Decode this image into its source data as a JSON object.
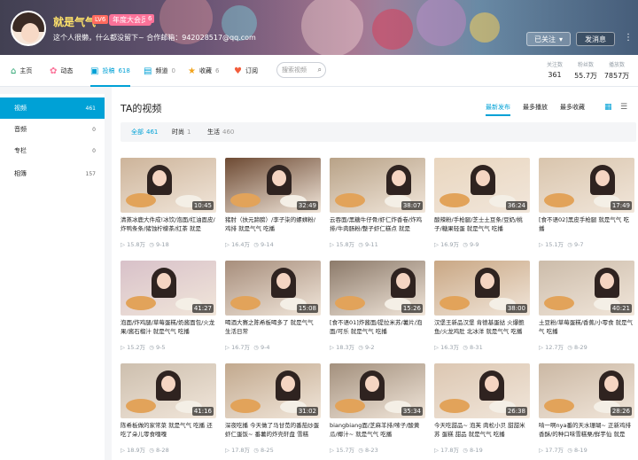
{
  "header": {
    "username": "就是气气",
    "level_badge": "LV6",
    "vip_badge": "年度大会员",
    "extra_badge": "6",
    "signature": "这个人很懒，什么都没留下~ 合作邮箱：942028517@qq.com",
    "follow_label": "已关注",
    "message_label": "发消息",
    "more_label": "⋮",
    "colors": {
      "accent": "#00a1d6",
      "vip": "#fb7299",
      "username": "#ffe26a"
    }
  },
  "nav": {
    "items": [
      {
        "icon": "home-icon",
        "label": "主页",
        "count": ""
      },
      {
        "icon": "activity-icon",
        "label": "动态",
        "count": ""
      },
      {
        "icon": "upload-icon",
        "label": "投稿",
        "count": "618"
      },
      {
        "icon": "channel-icon",
        "label": "频道",
        "count": "0"
      },
      {
        "icon": "favorite-icon",
        "label": "收藏",
        "count": "6"
      },
      {
        "icon": "subscribe-icon",
        "label": "订阅",
        "count": ""
      }
    ],
    "search_placeholder": "搜索视频",
    "stats": [
      {
        "label": "关注数",
        "value": "361"
      },
      {
        "label": "粉丝数",
        "value": "55.7万"
      },
      {
        "label": "播放数",
        "value": "7857万"
      }
    ]
  },
  "sidebar": {
    "items": [
      {
        "label": "视频",
        "count": "461"
      },
      {
        "label": "音频",
        "count": "0"
      },
      {
        "label": "专栏",
        "count": "0"
      },
      {
        "label": "相簿",
        "count": "157"
      }
    ]
  },
  "main": {
    "title": "TA的视频",
    "sorts": [
      "最新发布",
      "最多播放",
      "最多收藏"
    ],
    "view_icons": [
      "grid-view-icon",
      "list-view-icon"
    ],
    "filters": [
      {
        "label": "全部",
        "count": "461"
      },
      {
        "label": "时尚",
        "count": "1"
      },
      {
        "label": "生活",
        "count": "460"
      }
    ],
    "videos": [
      {
        "title": "清蒸冰鹿大件成!冰饮/泡面/红油面皮/炸鸭条条/猪蚀柠檬茶/红茶 就是",
        "duration": "10:45",
        "plays": "15.8万",
        "date": "9-18",
        "bg": "#cdb49a"
      },
      {
        "title": "猪肘（扶元蹄膀）/李子柒的螺蛳粉/鸡排 就是气气 吃播",
        "duration": "32:49",
        "plays": "16.4万",
        "date": "9-14",
        "bg": "#6d4a33"
      },
      {
        "title": "云吞面/黑糖牛仔骨/虾仁炸香卷/炸鸡排/牛肉肠粉/整子虾仁糕点 就是",
        "duration": "38:07",
        "plays": "15.8万",
        "date": "9-11",
        "bg": "#b8a287"
      },
      {
        "title": "酸辣粉/手枪腿/芝士土豆条/豆奶/桃子/糖果轻蛋 就是气气 吃播",
        "duration": "36:24",
        "plays": "16.9万",
        "date": "9-9",
        "bg": "#e9d6bf"
      },
      {
        "title": "[食不语02]黑皮手枪腿 就是气气 吃播",
        "duration": "17:49",
        "plays": "15.1万",
        "date": "9-7",
        "bg": "#d9c5ad"
      },
      {
        "title": "泡面/炸鸡腿/草莓蛋糕/奶酱面包/火龙果/酱石榴汁 就是气气 吃播",
        "duration": "41:27",
        "plays": "15.2万",
        "date": "9-5",
        "bg": "#d8c1c9"
      },
      {
        "title": "喝酒大赛之陈希板喝多了 就是气气 生活日常",
        "duration": "15:08",
        "plays": "16.7万",
        "date": "9-4",
        "bg": "#a78e7c"
      },
      {
        "title": "[食不语01]炸酱面/提拉米苏/薯片/泡面/可乐 就是气气 吃播",
        "duration": "15:26",
        "plays": "18.3万",
        "date": "9-2",
        "bg": "#8c7a6a"
      },
      {
        "title": "汉堡王新品汉堡 肯德基蛋挞 火爆鲍鱼/火龙鸡肚 北冰洋 就是气气 吃播",
        "duration": "38:00",
        "plays": "16.3万",
        "date": "8-31",
        "bg": "#c9a784"
      },
      {
        "title": "土豆粉/草莓蛋糕/香蕉/小零食 就是气气 吃播",
        "duration": "40:21",
        "plays": "12.7万",
        "date": "8-29",
        "bg": "#ccbcaa"
      },
      {
        "title": "陈希板做的家常菜 就是气气 吃播 还吃了朵儿零食嘎嘎",
        "duration": "41:16",
        "plays": "18.9万",
        "date": "8-28",
        "bg": "#cdbfae"
      },
      {
        "title": "深夜吃播 今天做了马甘苋的番茄炒蛋虾仁蛋饭~ 番薯的炸壳轩盘 雪糕",
        "duration": "31:02",
        "plays": "17.8万",
        "date": "8-25",
        "bg": "#c2a98e"
      },
      {
        "title": "biangbiang面/芝麻羊排/嗦子/酸黄瓜/椰汁~ 就是气气 吃播",
        "duration": "35:34",
        "plays": "15.7万",
        "date": "8-23",
        "bg": "#a3907d"
      },
      {
        "title": "今天吃甜品~ 泡芙 肉松小贝 甜甜米苏 蛋糕 甜品 就是气气 吃播",
        "duration": "26:38",
        "plays": "17.8万",
        "date": "8-19",
        "bg": "#dcc7b2"
      },
      {
        "title": "啃一啊nya番的天水珊瑚~ 正新鸡排 香酥/的种口味雪糕栗/鲜芋仙 就是",
        "duration": "28:26",
        "plays": "17.7万",
        "date": "8-19",
        "bg": "#cbb8a4"
      }
    ]
  }
}
